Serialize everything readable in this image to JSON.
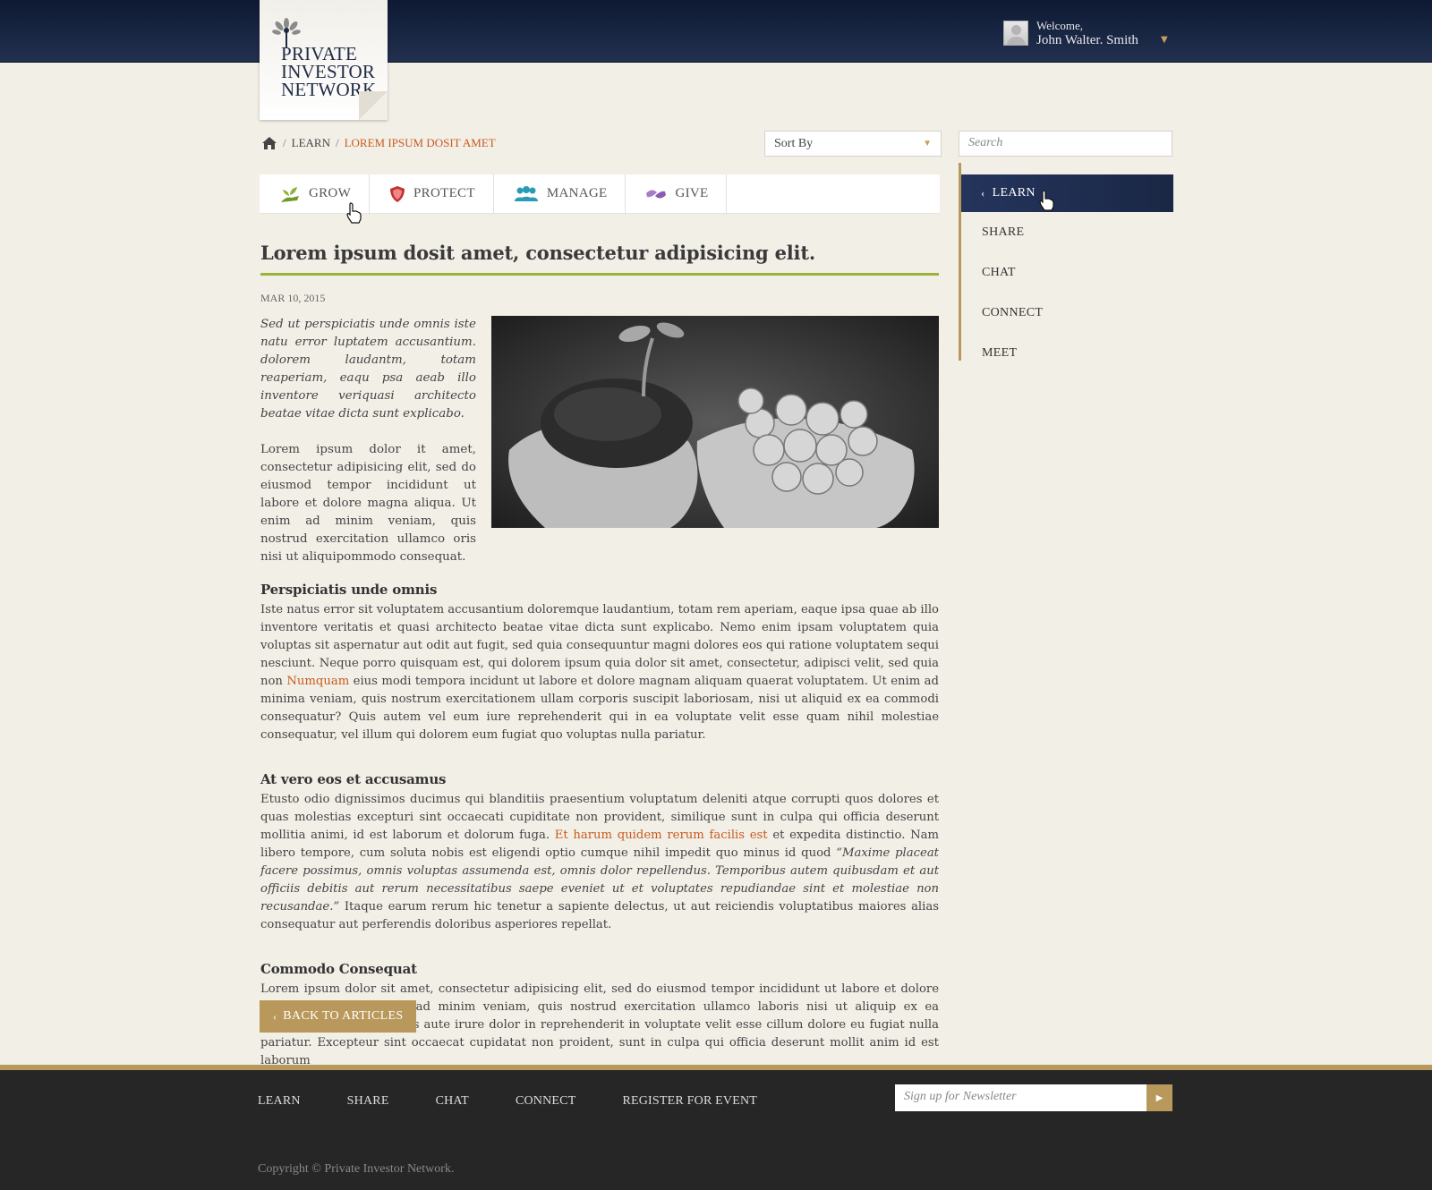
{
  "header": {
    "logo_lines": [
      "PRIVATE",
      "INVESTOR",
      "NETWORK"
    ],
    "welcome": "Welcome,",
    "user_name": "John Walter. Smith"
  },
  "breadcrumb": {
    "parent": "LEARN",
    "current": "LOREM IPSUM DOSIT AMET"
  },
  "toolbar": {
    "sort_label": "Sort By",
    "search_placeholder": "Search"
  },
  "tabs": [
    {
      "label": "GROW",
      "icon": "plant-icon"
    },
    {
      "label": "PROTECT",
      "icon": "shield-icon"
    },
    {
      "label": "MANAGE",
      "icon": "people-icon"
    },
    {
      "label": "GIVE",
      "icon": "handshake-icon"
    }
  ],
  "sidebar": {
    "items": [
      {
        "label": "LEARN"
      },
      {
        "label": "SHARE"
      },
      {
        "label": "CHAT"
      },
      {
        "label": "CONNECT"
      },
      {
        "label": "MEET"
      }
    ]
  },
  "article": {
    "title": "Lorem ipsum dosit amet, consectetur adipisicing elit.",
    "date": "MAR 10, 2015",
    "lead_italic": "Sed ut perspiciatis unde omnis iste natu error luptatem accusantium. dolorem laudantm, totam reaperiam, eaqu psa aeab illo inventore veriquasi architecto beatae vitae dicta sunt explicabo.",
    "lead_body": "Lorem ipsum dolor it amet, consectetur adipisicing elit, sed do eiusmod tempor incididunt ut labore et dolore magna aliqua. Ut enim ad minim veniam, quis nostrud exercitation ullamco oris nisi ut aliquipommodo consequat.",
    "sections": [
      {
        "heading": "Perspiciatis unde omnis",
        "p_before": "Iste natus error sit voluptatem accusantium doloremque laudantium, totam rem aperiam, eaque ipsa quae ab illo inventore veritatis et quasi architecto beatae vitae dicta sunt explicabo. Nemo enim ipsam voluptatem quia voluptas sit aspernatur aut odit aut fugit, sed quia consequuntur magni dolores eos qui ratione voluptatem sequi nesciunt. Neque porro quisquam est, qui dolorem ipsum quia dolor sit amet, consectetur, adipisci velit, sed quia non ",
        "link": "Numquam",
        "p_after": " eius modi tempora incidunt ut labore et dolore magnam aliquam quaerat voluptatem. Ut enim ad minima veniam, quis nostrum exercitationem ullam corporis suscipit laboriosam, nisi ut aliquid ex ea commodi consequatur? Quis autem vel eum iure reprehenderit qui in ea voluptate velit esse quam nihil molestiae consequatur, vel illum qui dolorem eum fugiat quo voluptas nulla pariatur."
      },
      {
        "heading": "At vero eos et accusamus",
        "p_before": "Etusto odio dignissimos ducimus qui blanditiis praesentium voluptatum deleniti atque corrupti quos dolores et quas molestias excepturi sint occaecati cupiditate non provident, similique sunt in culpa qui officia deserunt mollitia animi, id est laborum et dolorum fuga. ",
        "link": "Et harum quidem rerum facilis est",
        "p_mid": " et expedita distinctio. Nam libero tempore, cum soluta nobis est eligendi optio cumque nihil impedit quo minus id quod ",
        "quote": "“Maxime placeat facere possimus, omnis voluptas assumenda est, omnis dolor repellendus. Temporibus autem quibusdam et aut officiis debitis aut rerum necessitatibus saepe eveniet ut et voluptates repudiandae sint et molestiae non recusandae.”",
        "p_after": " Itaque earum rerum hic tenetur a sapiente delectus, ut aut reiciendis voluptatibus maiores alias consequatur aut perferendis doloribus asperiores repellat."
      },
      {
        "heading": "Commodo Consequat",
        "p_before": "Lorem ipsum dolor sit amet, consectetur adipisicing elit, sed do eiusmod tempor incididunt ut labore et dolore magna aliqua. Ut enim ad minim veniam, quis nostrud exercitation ullamco laboris nisi ut aliquip ex ea commodo consequat. Duis aute irure dolor in reprehenderit in voluptate velit esse cillum dolore eu fugiat nulla pariatur. Excepteur sint occaecat cupidatat non proident, sunt in culpa qui officia deserunt mollit anim id est laborum"
      }
    ],
    "back_label": "BACK TO ARTICLES"
  },
  "footer": {
    "nav": [
      "LEARN",
      "SHARE",
      "CHAT",
      "CONNECT",
      "REGISTER FOR EVENT"
    ],
    "newsletter_placeholder": "Sign up for Newsletter",
    "copyright": "Copyright © Private Investor Network."
  },
  "colors": {
    "accent_gold": "#b8985b",
    "link_orange": "#c75b1e",
    "title_rule_green": "#9bb23a",
    "navy": "#1a2745"
  }
}
